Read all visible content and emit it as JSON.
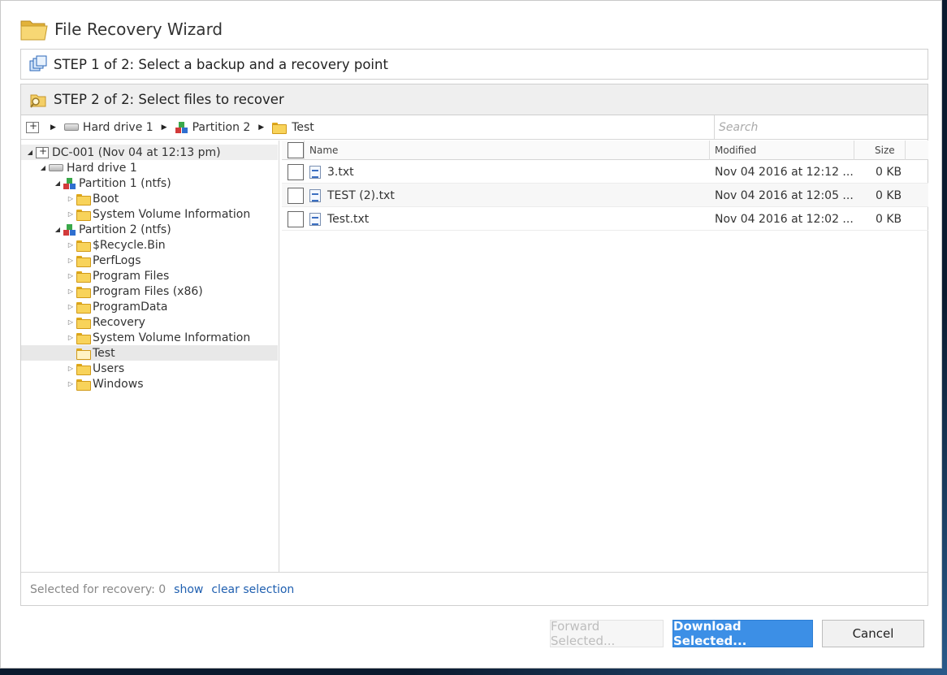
{
  "window": {
    "title": "File Recovery Wizard"
  },
  "step1": {
    "label": "STEP 1 of 2: Select a backup and a recovery point"
  },
  "step2": {
    "label": "STEP 2 of 2: Select files to recover"
  },
  "breadcrumb": {
    "items": [
      {
        "label": "Hard drive 1",
        "icon": "drive-icon"
      },
      {
        "label": "Partition 2",
        "icon": "partition-icon"
      },
      {
        "label": "Test",
        "icon": "folder-icon"
      }
    ]
  },
  "search": {
    "placeholder": "Search",
    "value": ""
  },
  "tree": {
    "root": "DC-001 (Nov 04 at 12:13 pm)",
    "drive": "Hard drive 1",
    "partition1": {
      "label": "Partition 1 (ntfs)",
      "children": [
        "Boot",
        "System Volume Information"
      ]
    },
    "partition2": {
      "label": "Partition 2 (ntfs)",
      "children": [
        "$Recycle.Bin",
        "PerfLogs",
        "Program Files",
        "Program Files (x86)",
        "ProgramData",
        "Recovery",
        "System Volume Information",
        "Test",
        "Users",
        "Windows"
      ]
    },
    "selected": "Test"
  },
  "filelist": {
    "columns": {
      "name": "Name",
      "modified": "Modified",
      "size": "Size"
    },
    "rows": [
      {
        "name": "3.txt",
        "modified": "Nov 04 2016 at 12:12 ...",
        "size": "0 KB"
      },
      {
        "name": "TEST (2).txt",
        "modified": "Nov 04 2016 at 12:05 ...",
        "size": "0 KB"
      },
      {
        "name": "Test.txt",
        "modified": "Nov 04 2016 at 12:02 ...",
        "size": "0 KB"
      }
    ]
  },
  "footer": {
    "selected_label": "Selected for recovery: 0",
    "show_link": "show",
    "clear_link": "clear selection"
  },
  "buttons": {
    "forward": "Forward Selected...",
    "download": "Download Selected...",
    "cancel": "Cancel"
  },
  "colors": {
    "accent": "#3c8fe6",
    "link": "#1f5fb0",
    "folder": "#f8d35a"
  }
}
